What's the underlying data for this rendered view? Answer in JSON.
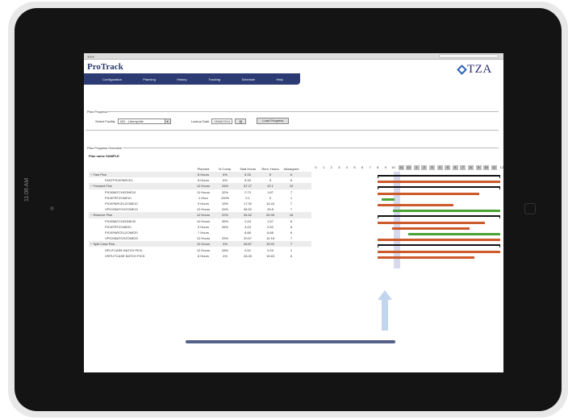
{
  "device": {
    "side_time": "11:06 AM"
  },
  "app": {
    "logo": "ProTrack",
    "brand": "TZA",
    "colors": {
      "nav": "#2c3b74",
      "bar_orange": "#cc5a2a",
      "bar_green": "#4aa334",
      "bar_black": "#111111",
      "now_band": "#c9cde9"
    }
  },
  "nav": {
    "items": [
      "Configuration",
      "Planning",
      "History",
      "Tracking",
      "Schedule",
      "Help"
    ]
  },
  "plan_progress": {
    "title": "Plan Progress",
    "facility_label": "Select Facility",
    "facility_value": "002 - Libertyville",
    "date_label": "Lookup Date",
    "date_value": "05/08/2014",
    "load_button": "Load Progress"
  },
  "overview": {
    "title": "Plan Progress Overview",
    "plan_name": "Plan name SAMPLE",
    "columns": [
      "Planned",
      "% Comp.",
      "Total Hours",
      "Rem. Hours",
      "#Assigned"
    ],
    "rows": [
      {
        "name": "− Fast Pick",
        "level": 0,
        "planned": "8 Hours",
        "comp": "6%",
        "total": "5.33",
        "rem": "5",
        "assigned": "6"
      },
      {
        "name": "FASTPICKPARCEL",
        "level": 1,
        "planned": "8 Hours",
        "comp": "6%",
        "total": "5.33",
        "rem": "5",
        "assigned": "6"
      },
      {
        "name": "− Forward Pick",
        "level": 0,
        "planned": "12 Hours",
        "comp": "26%",
        "total": "57.27",
        "rem": "42.1",
        "assigned": "15"
      },
      {
        "name": "PICKBATCHZONE10",
        "level": 1,
        "planned": "11 Hours",
        "comp": "32%",
        "total": "2.73",
        "rem": "1.87",
        "assigned": "7"
      },
      {
        "name": "PICKFRTZONE10",
        "level": 1,
        "planned": "1 Hour",
        "comp": "100%",
        "total": "0.1",
        "rem": "0",
        "assigned": "1"
      },
      {
        "name": "PICKPARCELZONE10",
        "level": 1,
        "planned": "9 Hours",
        "comp": "19%",
        "total": "17.92",
        "rem": "14.43",
        "assigned": "7"
      },
      {
        "name": "VPICKBATCHZONE10",
        "level": 1,
        "planned": "12 Hours",
        "comp": "29%",
        "total": "36.52",
        "rem": "25.8",
        "assigned": "7"
      },
      {
        "name": "− Reserve Pick",
        "level": 0,
        "planned": "12 Hours",
        "comp": "22%",
        "total": "34.62",
        "rem": "26.95",
        "assigned": "16"
      },
      {
        "name": "PICKBATCHZONE20",
        "level": 1,
        "planned": "10 Hours",
        "comp": "35%",
        "total": "2.43",
        "rem": "1.57",
        "assigned": "6"
      },
      {
        "name": "PICKFRTZONE20",
        "level": 1,
        "planned": "9 Hours",
        "comp": "26%",
        "total": "3.43",
        "rem": "2.52",
        "assigned": "6"
      },
      {
        "name": "PICKPARCELZONE20",
        "level": 1,
        "planned": "7 Hours",
        "comp": "",
        "total": "8.88",
        "rem": "8.88",
        "assigned": "6"
      },
      {
        "name": "VPICKBATCHZONE20",
        "level": 1,
        "planned": "12 Hours",
        "comp": "29%",
        "total": "20.67",
        "rem": "14.18",
        "assigned": "7"
      },
      {
        "name": "− Split Case Pick",
        "level": 0,
        "planned": "12 Hours",
        "comp": "4%",
        "total": "28.87",
        "rem": "15.92",
        "assigned": "7"
      },
      {
        "name": "SPLITCASE BATCH PICK",
        "level": 1,
        "planned": "12 Hours",
        "comp": "28%",
        "total": "0.42",
        "rem": "0.29",
        "assigned": "1"
      },
      {
        "name": "VSPLITCASE BATCH PICK",
        "level": 1,
        "planned": "8 Hours",
        "comp": "4%",
        "total": "28.45",
        "rem": "15.63",
        "assigned": "6"
      }
    ]
  },
  "gantt": {
    "ticks": [
      "0",
      "1",
      "2",
      "3",
      "4",
      "5",
      "6",
      "7",
      "8",
      "9",
      "10",
      "11",
      "12",
      "1",
      "2",
      "3",
      "4",
      "5",
      "6",
      "7",
      "8",
      "9",
      "10",
      "11",
      "12"
    ],
    "shaded_from": 11,
    "shaded_to": 23,
    "now_hour": 10.5,
    "bars": [
      {
        "row": 0,
        "start": 8.3,
        "end": 24,
        "color": "black"
      },
      {
        "row": 1,
        "start": 8.3,
        "end": 24,
        "color": "orange"
      },
      {
        "row": 2,
        "start": 8.3,
        "end": 24,
        "color": "black"
      },
      {
        "row": 3,
        "start": 8.3,
        "end": 20.8,
        "color": "orange"
      },
      {
        "row": 4,
        "start": 8.8,
        "end": 9.8,
        "color": "green"
      },
      {
        "row": 5,
        "start": 8.3,
        "end": 17.5,
        "color": "orange"
      },
      {
        "row": 6,
        "start": 10.3,
        "end": 24,
        "color": "green"
      },
      {
        "row": 7,
        "start": 8.3,
        "end": 24,
        "color": "black"
      },
      {
        "row": 8,
        "start": 8.3,
        "end": 21.5,
        "color": "orange"
      },
      {
        "row": 9,
        "start": 10.2,
        "end": 19.5,
        "color": "orange"
      },
      {
        "row": 10,
        "start": 12.2,
        "end": 24,
        "color": "green"
      },
      {
        "row": 11,
        "start": 8.3,
        "end": 24,
        "color": "orange"
      },
      {
        "row": 12,
        "start": 8.3,
        "end": 24,
        "color": "black"
      },
      {
        "row": 13,
        "start": 8.3,
        "end": 24,
        "color": "orange"
      },
      {
        "row": 14,
        "start": 8.3,
        "end": 20.2,
        "color": "orange"
      }
    ]
  }
}
